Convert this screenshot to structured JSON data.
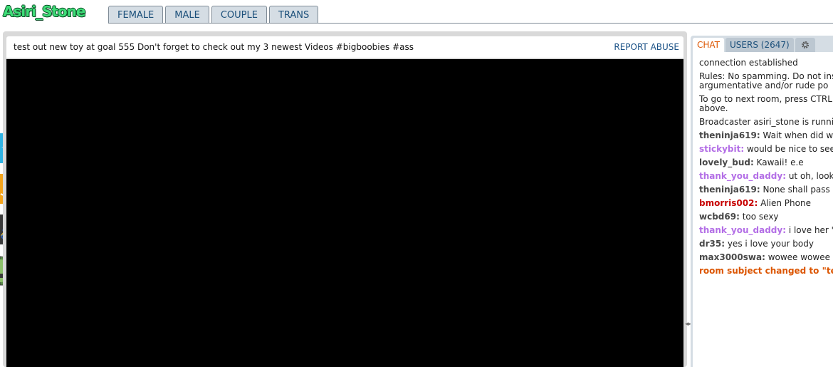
{
  "header": {
    "logo_text": "Asiri_Stone",
    "gender_tabs": [
      "FEMALE",
      "MALE",
      "COUPLE",
      "TRANS"
    ]
  },
  "video": {
    "subject": "test out new toy at goal 555 Don't forget to check out my 3 newest Videos #bigboobies #ass",
    "report_abuse": "REPORT ABUSE"
  },
  "side_buttons": [
    "twitter-icon",
    "amazon-icon",
    "tool-icon",
    "shield-icon"
  ],
  "chat": {
    "tabs": {
      "chat": "CHAT",
      "users": "USERS (2647)"
    },
    "system_messages": [
      "connection established",
      "Rules: No spamming. Do not insist any argumentative and/or rude po",
      "To go to next room, press CTRL+ tab above.",
      "Broadcaster asiri_stone is running t"
    ],
    "messages": [
      {
        "user": "theninja619:",
        "text": " Wait when did we",
        "color": "#494949"
      },
      {
        "user": "stickybit:",
        "text": " would be nice to see th",
        "color": "#b36ee6"
      },
      {
        "user": "lovely_bud:",
        "text": " Kawaii! e.e",
        "color": "#494949"
      },
      {
        "user": "thank_you_daddy:",
        "text": " ut oh, look c",
        "color": "#b36ee6"
      },
      {
        "user": "theninja619:",
        "text": " None shall pass",
        "color": "#494949"
      },
      {
        "user": "bmorris002:",
        "text": " Alien Phone",
        "color": "#c70000"
      },
      {
        "user": "wcbd69:",
        "text": " too sexy",
        "color": "#494949"
      },
      {
        "user": "thank_you_daddy:",
        "text": " i love her \"se",
        "color": "#b36ee6"
      },
      {
        "user": "dr35:",
        "text": " yes i love your body",
        "color": "#494949"
      },
      {
        "user": "max3000swa:",
        "text": " wowee wowee",
        "color": "#494949"
      }
    ],
    "notice": "room subject changed to \"test"
  },
  "colors": {
    "accent_orange": "#dc5500",
    "link_blue": "#1a5186",
    "tab_bg": "#d5dde4",
    "logo_green": "#3edc77"
  }
}
